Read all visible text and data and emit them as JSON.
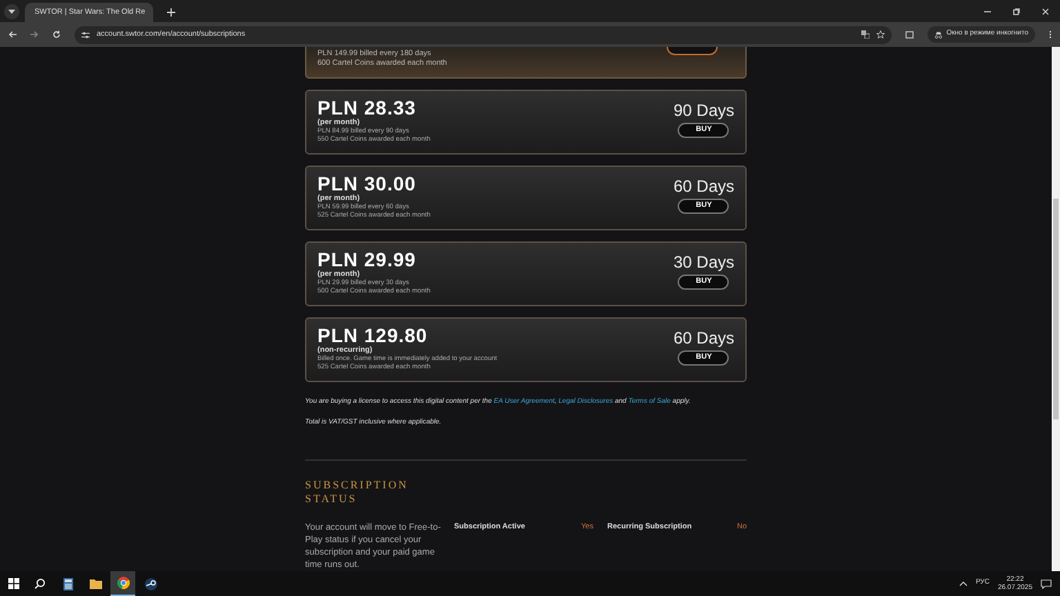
{
  "browser": {
    "tab_title": "SWTOR | Star Wars: The Old Re",
    "url": "account.swtor.com/en/account/subscriptions",
    "incognito_label": "Окно в режиме инкогнито"
  },
  "plans": [
    {
      "kind": "partial",
      "selected": true,
      "billing": "PLN 149.99 billed every 180 days",
      "coins": "600 Cartel Coins awarded each month"
    },
    {
      "kind": "full",
      "selected": false,
      "price": "PLN 28.33",
      "period": "(per month)",
      "billing": "PLN 84.99 billed every 90 days",
      "coins": "550 Cartel Coins awarded each month",
      "duration": "90 Days",
      "button": "BUY"
    },
    {
      "kind": "full",
      "selected": false,
      "price": "PLN 30.00",
      "period": "(per month)",
      "billing": "PLN 59.99 billed every 60 days",
      "coins": "525 Cartel Coins awarded each month",
      "duration": "60 Days",
      "button": "BUY"
    },
    {
      "kind": "full",
      "selected": false,
      "price": "PLN 29.99",
      "period": "(per month)",
      "billing": "PLN 29.99 billed every 30 days",
      "coins": "500 Cartel Coins awarded each month",
      "duration": "30 Days",
      "button": "BUY"
    },
    {
      "kind": "full",
      "selected": false,
      "price": "PLN 129.80",
      "period": "(non-recurring)",
      "billing": "Billed once. Game time is immediately added to your account",
      "coins": "525 Cartel Coins awarded each month",
      "duration": "60 Days",
      "button": "BUY"
    }
  ],
  "legal": [
    {
      "kind": "text",
      "text": "You are buying a license to access this digital content per the "
    },
    {
      "kind": "link",
      "text": "EA User Agreement"
    },
    {
      "kind": "text",
      "text": ", "
    },
    {
      "kind": "link",
      "text": "Legal Disclosures"
    },
    {
      "kind": "text",
      "text": " and "
    },
    {
      "kind": "link",
      "text": "Terms of Sale"
    },
    {
      "kind": "text",
      "text": " apply."
    }
  ],
  "tax_note": "Total is VAT/GST inclusive where applicable.",
  "subscription_status": {
    "heading": "SUBSCRIPTION STATUS",
    "description": "Your account will move to Free-to-Play status if you cancel your subscription and your paid game time runs out.",
    "items": [
      {
        "label": "Subscription Active",
        "value": "Yes"
      },
      {
        "label": "Recurring Subscription",
        "value": "No"
      }
    ]
  },
  "taskbar": {
    "apps": [
      {
        "kind": "search",
        "selected": false
      },
      {
        "kind": "calculator",
        "selected": false
      },
      {
        "kind": "folder",
        "selected": false
      },
      {
        "kind": "chrome",
        "selected": true
      },
      {
        "kind": "steam",
        "selected": false
      }
    ],
    "language": "РУС",
    "time": "22:22",
    "date": "26.07.2025"
  }
}
